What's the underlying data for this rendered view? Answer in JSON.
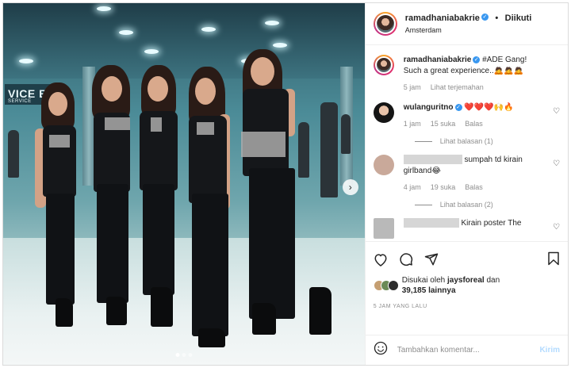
{
  "post": {
    "username": "ramadhaniabakrie",
    "follow_sep": "•",
    "follow_status": "Diikuti",
    "location": "Amsterdam",
    "sign_text": "VICE BA",
    "sign_sub": "SERVICE",
    "carousel_next": "›",
    "carousel_pages": 3,
    "carousel_active": 1
  },
  "caption": {
    "username": "ramadhaniabakrie",
    "text": "#ADE Gang! Such a great experience..🙇🙇🙇",
    "time": "5 jam",
    "translate": "Lihat terjemahan"
  },
  "comments": [
    {
      "username": "wulanguritno",
      "text": " ❤️❤️❤️🙌🔥",
      "time": "1 jam",
      "likes": "15 suka",
      "reply": "Balas",
      "replies": "Lihat balasan (1)"
    },
    {
      "username": "",
      "text": "sumpah td kirain girlband😂",
      "time": "4 jam",
      "likes": "19 suka",
      "reply": "Balas",
      "replies": "Lihat balasan (2)"
    },
    {
      "username": "",
      "text": "Kirain poster The",
      "time": "",
      "likes": "",
      "reply": "",
      "replies": ""
    }
  ],
  "likes": {
    "prefix": "Disukai oleh",
    "user": "jaysforeal",
    "and": "dan",
    "count": "39,185 lainnya"
  },
  "timestamp": "5 JAM YANG LALU",
  "add_comment": {
    "placeholder": "Tambahkan komentar...",
    "post_label": "Kirim"
  },
  "icons": [
    "heart-icon",
    "comment-icon",
    "share-icon",
    "bookmark-icon",
    "emoji-icon",
    "verified-icon"
  ],
  "colors": {
    "accent": "#3897f0",
    "post_disabled": "#b3dbff",
    "heart": "#ed4956"
  }
}
